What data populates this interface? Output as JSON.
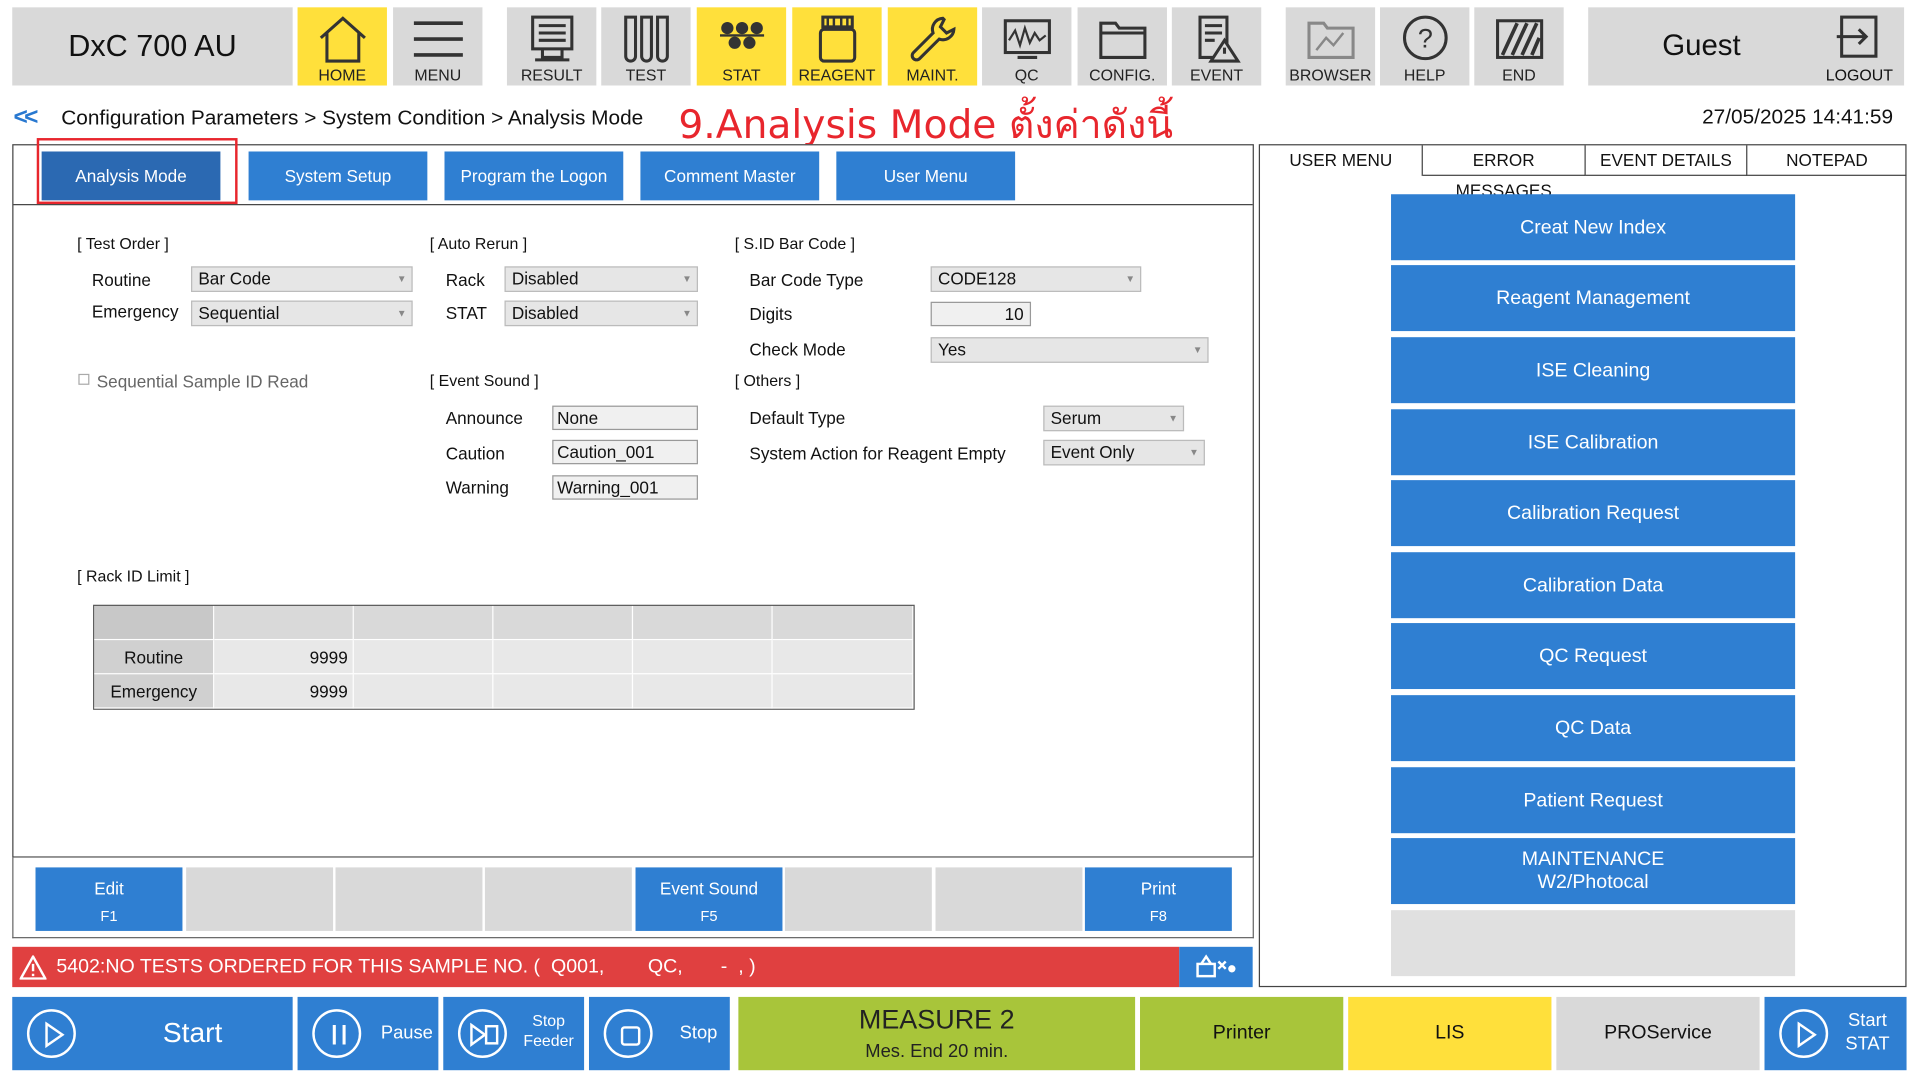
{
  "app": {
    "product": "DxC 700 AU",
    "user": "Guest",
    "logout": "LOGOUT"
  },
  "toolbar": [
    {
      "label": "HOME",
      "icon": "home-icon"
    },
    {
      "label": "MENU",
      "icon": "menu-icon"
    },
    {
      "label": "RESULT",
      "icon": "result-icon"
    },
    {
      "label": "TEST",
      "icon": "test-tubes-icon"
    },
    {
      "label": "STAT",
      "icon": "stat-icon"
    },
    {
      "label": "REAGENT",
      "icon": "reagent-icon"
    },
    {
      "label": "MAINT.",
      "icon": "wrench-icon"
    },
    {
      "label": "QC",
      "icon": "qc-icon"
    },
    {
      "label": "CONFIG.",
      "icon": "folder-icon"
    },
    {
      "label": "EVENT",
      "icon": "event-icon"
    },
    {
      "label": "BROWSER",
      "icon": "browser-icon"
    },
    {
      "label": "HELP",
      "icon": "help-icon"
    },
    {
      "label": "END",
      "icon": "end-icon"
    }
  ],
  "breadcrumb": {
    "back": "<<",
    "path": "Configuration Parameters > System Condition > Analysis Mode",
    "note": "9.Analysis Mode ตั้งค่าดังนี้",
    "datetime": "27/05/2025 14:41:59"
  },
  "tabs": [
    "Analysis Mode",
    "System Setup",
    "Program the Logon",
    "Comment Master",
    "User Menu"
  ],
  "test_order": {
    "title": "[ Test Order ]",
    "routine_label": "Routine",
    "routine_value": "Bar Code",
    "emergency_label": "Emergency",
    "emergency_value": "Sequential",
    "seq_read_label": "Sequential Sample ID Read"
  },
  "auto_rerun": {
    "title": "[ Auto Rerun ]",
    "rack_label": "Rack",
    "rack_value": "Disabled",
    "stat_label": "STAT",
    "stat_value": "Disabled"
  },
  "sid_barcode": {
    "title": "[ S.ID Bar Code ]",
    "type_label": "Bar Code Type",
    "type_value": "CODE128",
    "digits_label": "Digits",
    "digits_value": "10",
    "check_label": "Check Mode",
    "check_value": "Yes"
  },
  "event_sound": {
    "title": "[ Event Sound ]",
    "announce_label": "Announce",
    "announce_value": "None",
    "caution_label": "Caution",
    "caution_value": "Caution_001",
    "warning_label": "Warning",
    "warning_value": "Warning_001"
  },
  "others": {
    "title": "[ Others ]",
    "default_label": "Default Type",
    "default_value": "Serum",
    "action_label": "System Action for Reagent Empty",
    "action_value": "Event Only"
  },
  "rack_id": {
    "title": "[ Rack ID Limit ]",
    "rows": [
      {
        "label": "Routine",
        "value": "9999"
      },
      {
        "label": "Emergency",
        "value": "9999"
      }
    ]
  },
  "fkeys": [
    {
      "label": "Edit",
      "key": "F1"
    },
    {
      "label": "",
      "key": ""
    },
    {
      "label": "",
      "key": ""
    },
    {
      "label": "",
      "key": ""
    },
    {
      "label": "Event Sound",
      "key": "F5"
    },
    {
      "label": "",
      "key": ""
    },
    {
      "label": "",
      "key": ""
    },
    {
      "label": "Print",
      "key": "F8"
    }
  ],
  "error": {
    "message": "5402:NO TESTS ORDERED FOR THIS SAMPLE NO. (  Q001,        QC,       -  , )"
  },
  "right_tabs": [
    "USER MENU",
    "ERROR MESSAGES",
    "EVENT DETAILS",
    "NOTEPAD"
  ],
  "user_menu": [
    "Creat New Index",
    "Reagent Management",
    "ISE Cleaning",
    "ISE Calibration",
    "Calibration Request",
    "Calibration Data",
    "QC Request",
    "QC Data",
    "Patient Request",
    "MAINTENANCE\nW2/Photocal",
    ""
  ],
  "bottom": {
    "start": "Start",
    "pause": "Pause",
    "stop_feeder_1": "Stop",
    "stop_feeder_2": "Feeder",
    "stop": "Stop",
    "measure_1": "MEASURE 2",
    "measure_2": "Mes. End 20 min.",
    "printer": "Printer",
    "lis": "LIS",
    "proservice": "PROService",
    "start_stat_1": "Start",
    "start_stat_2": "STAT"
  },
  "colors": {
    "accent": "#2f7fd2",
    "yellow": "#ffe03b",
    "green": "#a8c53a",
    "error": "#e04040",
    "gray": "#d9d9d9"
  }
}
